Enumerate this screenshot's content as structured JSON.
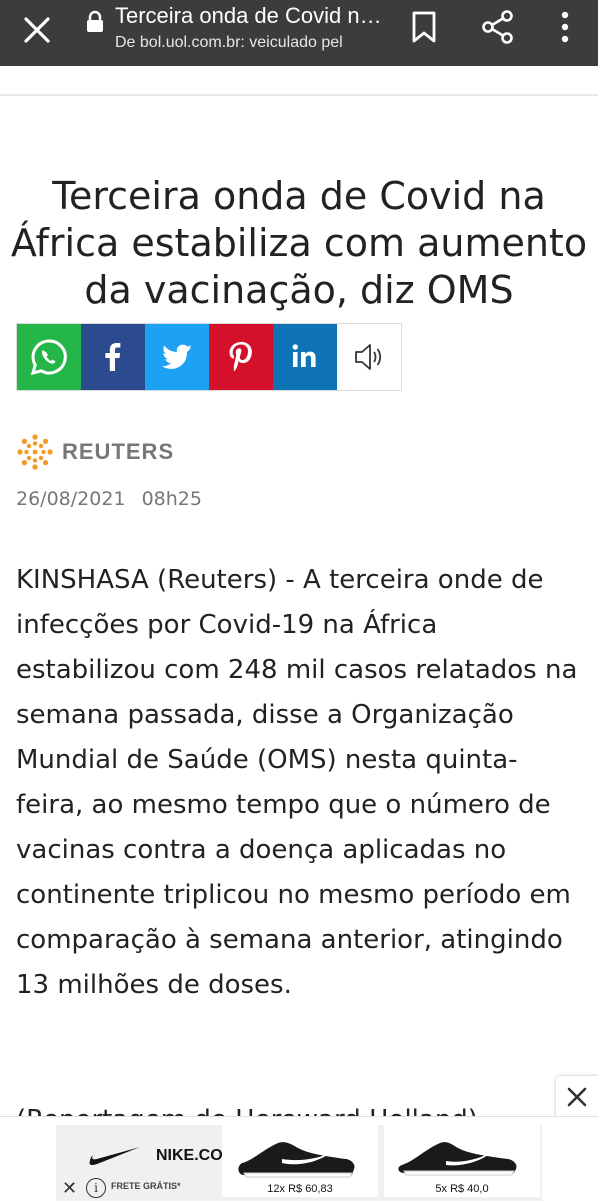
{
  "browser": {
    "title": "Terceira onda de Covid na África estabiliza com aumento da vacinação, diz OMS",
    "url": "De bol.uol.com.br: veiculado pel"
  },
  "article": {
    "headline": "Terceira onda de Covid na África estabiliza com aumento da vacinação, diz OMS",
    "source": "REUTERS",
    "date": "26/08/2021",
    "time": "08h25",
    "body": "KINSHASA (Reuters) - A terceira onde de infecções por Covid-19 na África estabilizou com 248 mil casos relatados na semana passada, disse a Organização Mundial de Saúde (OMS) nesta quinta-feira, ao mesmo tempo que o número de vacinas contra a doença aplicadas no continente triplicou no mesmo período em comparação à semana anterior, atingindo 13 milhões de doses.",
    "body_next": "(Reportagem de Hereward Holland)"
  },
  "share_buttons": [
    {
      "name": "whatsapp",
      "color": "#25b64a"
    },
    {
      "name": "facebook",
      "color": "#2c4b8f"
    },
    {
      "name": "twitter",
      "color": "#1da1f2"
    },
    {
      "name": "pinterest",
      "color": "#d4102a"
    },
    {
      "name": "linkedin",
      "color": "#0f74b5"
    },
    {
      "name": "audio",
      "color": "#ffffff"
    }
  ],
  "ad": {
    "brand": "NIKE.COM",
    "shipping": "FRETE GRÁTIS*",
    "products": [
      {
        "price": "12x R$ 60,83"
      },
      {
        "price": "5x R$ 40,0"
      }
    ]
  }
}
